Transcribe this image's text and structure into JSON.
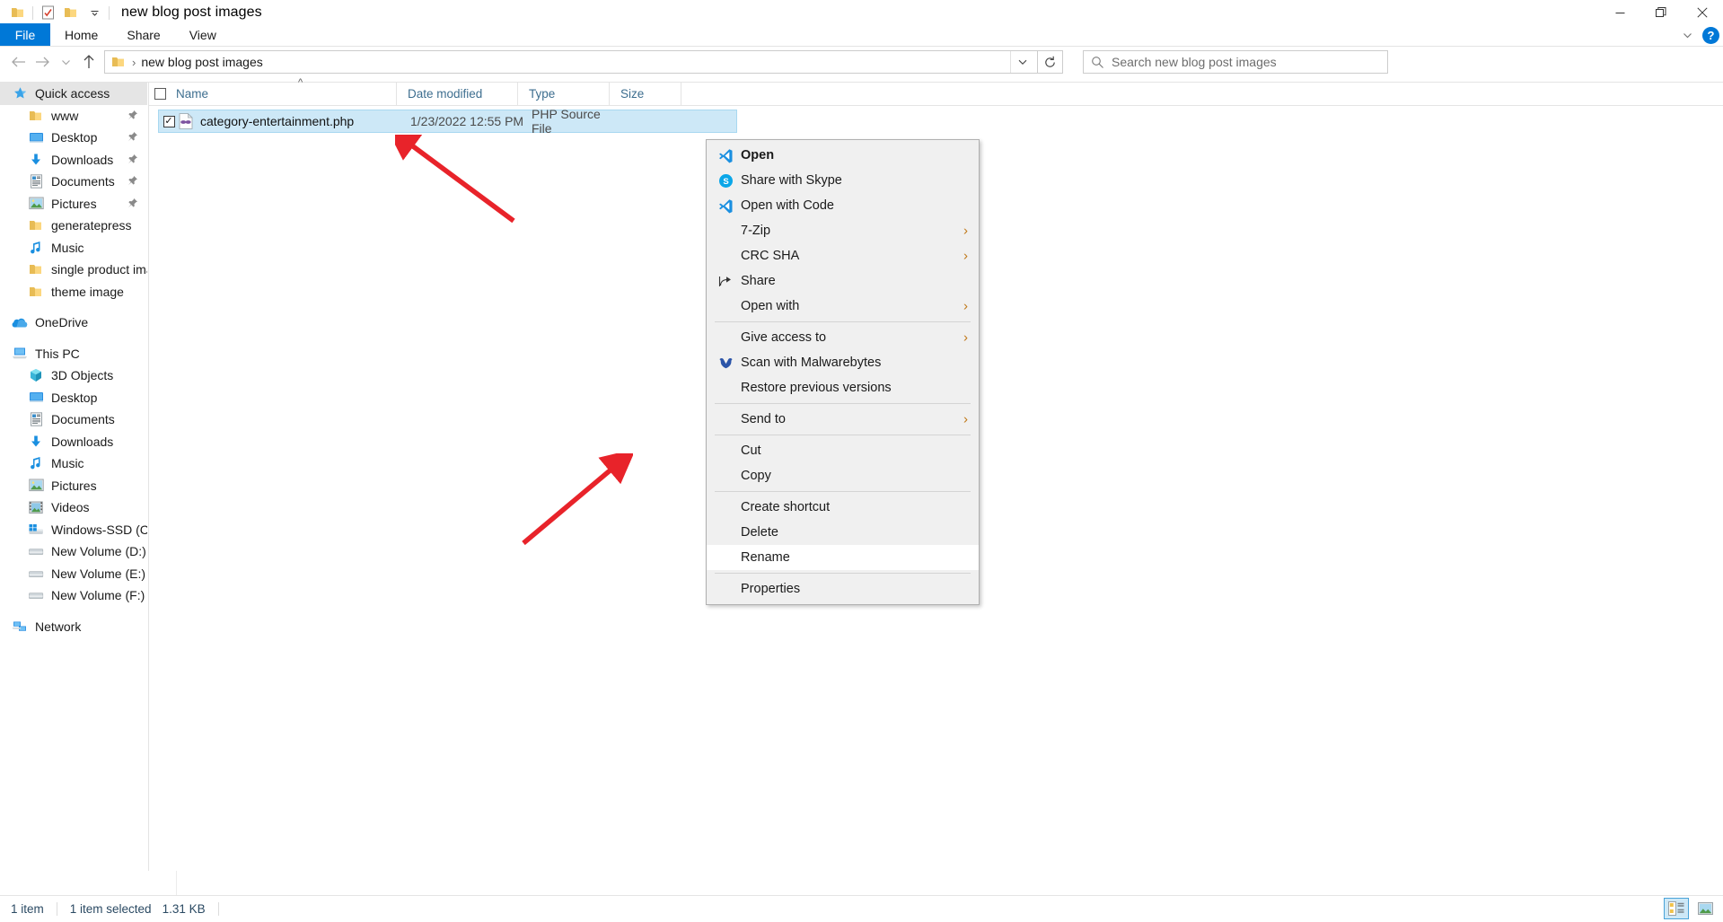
{
  "window": {
    "title": "new blog post images",
    "quick_access_icons": [
      "folder-icon",
      "properties-icon",
      "new-folder-icon",
      "customize-qat-chevron-icon"
    ],
    "controls": {
      "minimize": "minimize-icon",
      "maximize": "maximize-icon",
      "close": "close-icon"
    }
  },
  "ribbon": {
    "tabs": [
      {
        "label": "File",
        "active": true
      },
      {
        "label": "Home",
        "active": false
      },
      {
        "label": "Share",
        "active": false
      },
      {
        "label": "View",
        "active": false
      }
    ],
    "collapse_icon": "chevron-down-icon",
    "help_label": "?"
  },
  "address_bar": {
    "back_icon": "arrow-left-icon",
    "forward_icon": "arrow-right-icon",
    "recent_icon": "chevron-down-icon",
    "up_icon": "arrow-up-icon",
    "breadcrumb_icon": "folder-icon",
    "breadcrumb_separator": "›",
    "path": "new blog post images",
    "dropdown_icon": "chevron-down-icon",
    "refresh_icon": "refresh-icon"
  },
  "search": {
    "icon": "search-icon",
    "placeholder": "Search new blog post images"
  },
  "columns": [
    {
      "key": "name",
      "label": "Name",
      "sorted": true,
      "sort_dir": "asc"
    },
    {
      "key": "date",
      "label": "Date modified"
    },
    {
      "key": "type",
      "label": "Type"
    },
    {
      "key": "size",
      "label": "Size"
    }
  ],
  "files": [
    {
      "name": "category-entertainment.php",
      "date_modified": "1/23/2022 12:55 PM",
      "type": "PHP Source File",
      "size": "",
      "icon": "php-file-icon",
      "selected": true,
      "checked": true
    }
  ],
  "sidebar": {
    "groups": [
      {
        "header": {
          "label": "Quick access",
          "icon": "quick-access-star-icon",
          "selected": true
        },
        "items": [
          {
            "label": "www",
            "icon": "folder-icon",
            "pinned": true
          },
          {
            "label": "Desktop",
            "icon": "desktop-icon",
            "pinned": true
          },
          {
            "label": "Downloads",
            "icon": "downloads-icon",
            "pinned": true
          },
          {
            "label": "Documents",
            "icon": "documents-icon",
            "pinned": true
          },
          {
            "label": "Pictures",
            "icon": "pictures-icon",
            "pinned": true
          },
          {
            "label": "generatepress",
            "icon": "folder-icon",
            "pinned": false
          },
          {
            "label": "Music",
            "icon": "music-icon",
            "pinned": false
          },
          {
            "label": "single product imag",
            "icon": "folder-icon",
            "pinned": false
          },
          {
            "label": "theme image",
            "icon": "folder-icon",
            "pinned": false
          }
        ]
      },
      {
        "header": {
          "label": "OneDrive",
          "icon": "onedrive-cloud-icon",
          "selected": false
        },
        "items": []
      },
      {
        "header": {
          "label": "This PC",
          "icon": "this-pc-icon",
          "selected": false
        },
        "items": [
          {
            "label": "3D Objects",
            "icon": "3d-objects-icon",
            "pinned": false
          },
          {
            "label": "Desktop",
            "icon": "desktop-icon",
            "pinned": false
          },
          {
            "label": "Documents",
            "icon": "documents-icon",
            "pinned": false
          },
          {
            "label": "Downloads",
            "icon": "downloads-icon",
            "pinned": false
          },
          {
            "label": "Music",
            "icon": "music-icon",
            "pinned": false
          },
          {
            "label": "Pictures",
            "icon": "pictures-icon",
            "pinned": false
          },
          {
            "label": "Videos",
            "icon": "videos-icon",
            "pinned": false
          },
          {
            "label": "Windows-SSD (C:)",
            "icon": "windows-drive-icon",
            "pinned": false
          },
          {
            "label": "New Volume (D:)",
            "icon": "drive-icon",
            "pinned": false
          },
          {
            "label": "New Volume (E:)",
            "icon": "drive-icon",
            "pinned": false
          },
          {
            "label": "New Volume (F:)",
            "icon": "drive-icon",
            "pinned": false
          }
        ]
      },
      {
        "header": {
          "label": "Network",
          "icon": "network-icon",
          "selected": false
        },
        "items": []
      }
    ]
  },
  "context_menu": {
    "items": [
      {
        "label": "Open",
        "icon": "vscode-icon",
        "bold": true,
        "submenu": false,
        "highlighted": false
      },
      {
        "label": "Share with Skype",
        "icon": "skype-icon",
        "bold": false,
        "submenu": false,
        "highlighted": false
      },
      {
        "label": "Open with Code",
        "icon": "vscode-icon",
        "bold": false,
        "submenu": false,
        "highlighted": false
      },
      {
        "label": "7-Zip",
        "icon": null,
        "bold": false,
        "submenu": true,
        "highlighted": false
      },
      {
        "label": "CRC SHA",
        "icon": null,
        "bold": false,
        "submenu": true,
        "highlighted": false
      },
      {
        "label": "Share",
        "icon": "share-icon",
        "bold": false,
        "submenu": false,
        "highlighted": false
      },
      {
        "label": "Open with",
        "icon": null,
        "bold": false,
        "submenu": true,
        "highlighted": false
      },
      {
        "separator": true
      },
      {
        "label": "Give access to",
        "icon": null,
        "bold": false,
        "submenu": true,
        "highlighted": false
      },
      {
        "label": "Scan with Malwarebytes",
        "icon": "malwarebytes-icon",
        "bold": false,
        "submenu": false,
        "highlighted": false
      },
      {
        "label": "Restore previous versions",
        "icon": null,
        "bold": false,
        "submenu": false,
        "highlighted": false
      },
      {
        "separator": true
      },
      {
        "label": "Send to",
        "icon": null,
        "bold": false,
        "submenu": true,
        "highlighted": false
      },
      {
        "separator": true
      },
      {
        "label": "Cut",
        "icon": null,
        "bold": false,
        "submenu": false,
        "highlighted": false
      },
      {
        "label": "Copy",
        "icon": null,
        "bold": false,
        "submenu": false,
        "highlighted": false
      },
      {
        "separator": true
      },
      {
        "label": "Create shortcut",
        "icon": null,
        "bold": false,
        "submenu": false,
        "highlighted": false
      },
      {
        "label": "Delete",
        "icon": null,
        "bold": false,
        "submenu": false,
        "highlighted": false
      },
      {
        "label": "Rename",
        "icon": null,
        "bold": false,
        "submenu": false,
        "highlighted": true
      },
      {
        "separator": true
      },
      {
        "label": "Properties",
        "icon": null,
        "bold": false,
        "submenu": false,
        "highlighted": false
      }
    ],
    "submenu_arrow": "chevron-right-icon"
  },
  "status_bar": {
    "item_count": "1 item",
    "selection_count": "1 item selected",
    "selection_size": "1.31 KB",
    "views": [
      {
        "name": "details-view",
        "active": true
      },
      {
        "name": "large-icons-view",
        "active": false
      }
    ]
  },
  "annotations": {
    "arrow_color": "#e8232a",
    "arrows": [
      {
        "name": "arrow-pointing-to-filename"
      },
      {
        "name": "arrow-pointing-to-rename"
      }
    ]
  },
  "colors": {
    "accent": "#0078d7",
    "selection": "#cde8f7",
    "menu_bg": "#f0f0f0",
    "header_text": "#3d6e8f"
  }
}
